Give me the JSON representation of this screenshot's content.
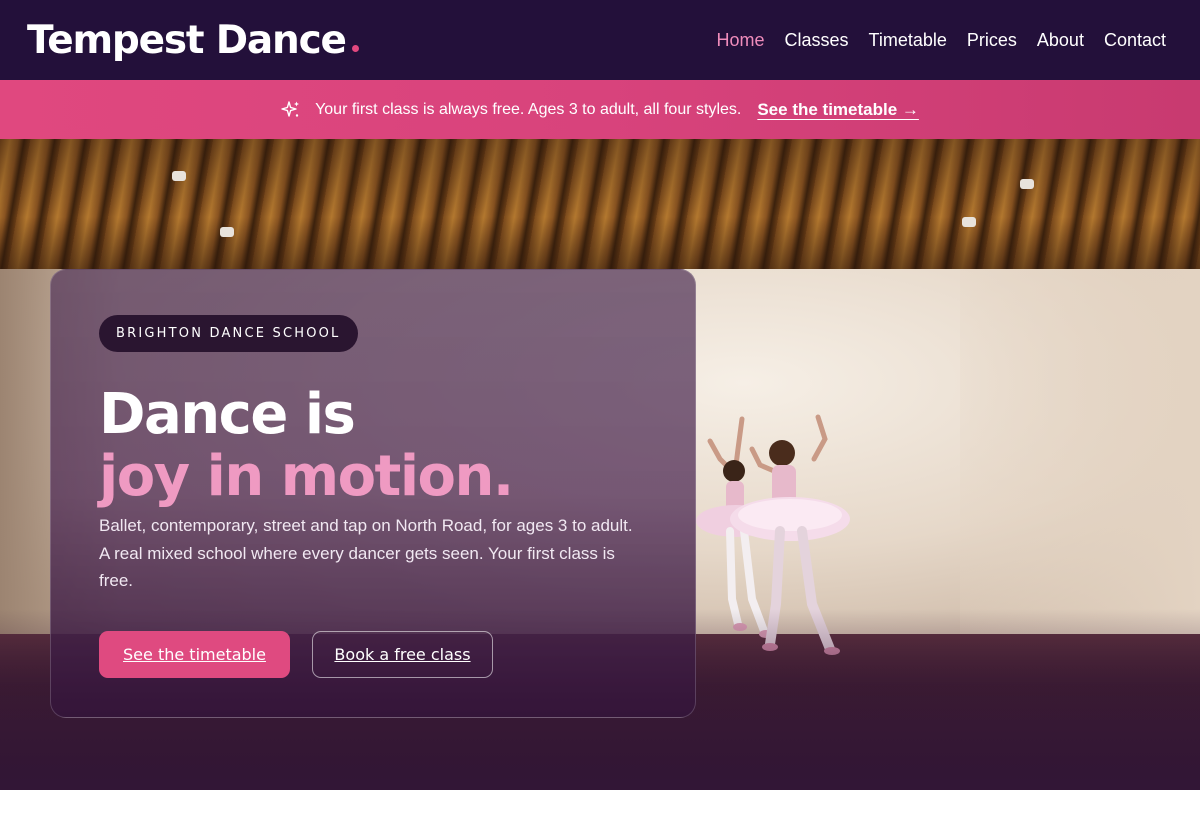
{
  "header": {
    "logo": "Tempest Dance",
    "nav": [
      {
        "label": "Home",
        "active": true
      },
      {
        "label": "Classes",
        "active": false
      },
      {
        "label": "Timetable",
        "active": false
      },
      {
        "label": "Prices",
        "active": false
      },
      {
        "label": "About",
        "active": false
      },
      {
        "label": "Contact",
        "active": false
      }
    ]
  },
  "announcement": {
    "icon": "sparkle-icon",
    "text": "Your first class is always free. Ages 3 to adult, all four styles.",
    "link_label": "See the timetable →"
  },
  "hero": {
    "tag": "BRIGHTON DANCE SCHOOL",
    "headline_line1": "Dance is",
    "headline_line2": "joy in motion.",
    "lead": "Ballet, contemporary, street and tap on North Road, for ages 3 to adult. A real mixed school where every dancer gets seen. Your first class is free.",
    "primary_button": "See the timetable",
    "secondary_button": "Book a free class"
  },
  "colors": {
    "header_bg": "#23103a",
    "accent_pink": "#e2487f",
    "nav_active": "#ef8cbb",
    "headline_accent": "#ef9ac2"
  }
}
